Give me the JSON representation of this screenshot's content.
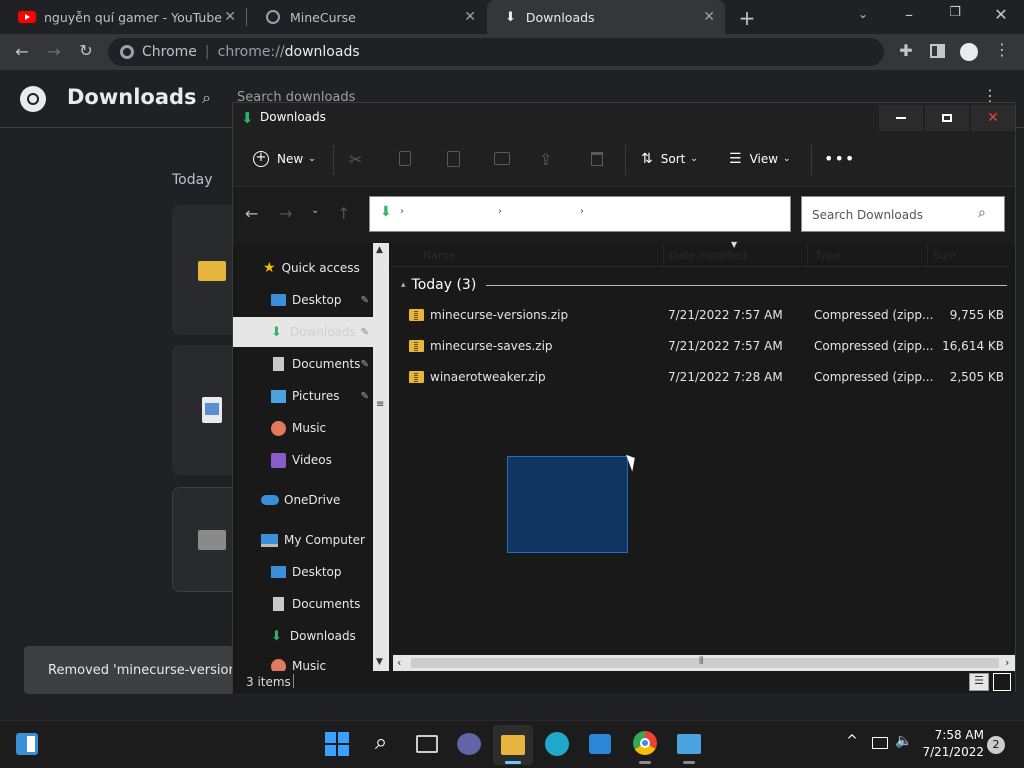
{
  "chrome": {
    "tabs": [
      {
        "title": "nguyễn quí gamer - YouTube"
      },
      {
        "title": "MineCurse"
      },
      {
        "title": "Downloads"
      }
    ],
    "omnibox": {
      "site": "Chrome",
      "url_prefix": "chrome://",
      "url_path": "downloads"
    },
    "downloads_page": {
      "title": "Downloads",
      "search_placeholder": "Search downloads",
      "section": "Today",
      "toast": "Removed 'minecurse-versions.zi"
    }
  },
  "explorer": {
    "title": "Downloads",
    "commands": {
      "new": "New",
      "sort": "Sort",
      "view": "View"
    },
    "search_placeholder": "Search Downloads",
    "nav": {
      "quick_access": "Quick access",
      "items": [
        "Desktop",
        "Downloads",
        "Documents",
        "Pictures",
        "Music",
        "Videos"
      ],
      "onedrive": "OneDrive",
      "my_computer": "My Computer",
      "mc_items": [
        "Desktop",
        "Documents",
        "Downloads",
        "Music"
      ]
    },
    "columns": [
      "Name",
      "Date modified",
      "Type",
      "Size"
    ],
    "group": "Today (3)",
    "files": [
      {
        "name": "minecurse-versions.zip",
        "date": "7/21/2022 7:57 AM",
        "type": "Compressed (zipp...",
        "size": "9,755 KB"
      },
      {
        "name": "minecurse-saves.zip",
        "date": "7/21/2022 7:57 AM",
        "type": "Compressed (zipp...",
        "size": "16,614 KB"
      },
      {
        "name": "winaerotweaker.zip",
        "date": "7/21/2022 7:28 AM",
        "type": "Compressed (zipp...",
        "size": "2,505 KB"
      }
    ],
    "status": "3 items"
  },
  "taskbar": {
    "time": "7:58 AM",
    "date": "7/21/2022",
    "notifications": "2"
  },
  "colors": {
    "accent": "#0078d4",
    "chrome_bg": "#202124",
    "explorer_bg": "#191919",
    "folder": "#e6b53d",
    "download_green": "#2fb56a",
    "close_red": "#c42b1c"
  }
}
